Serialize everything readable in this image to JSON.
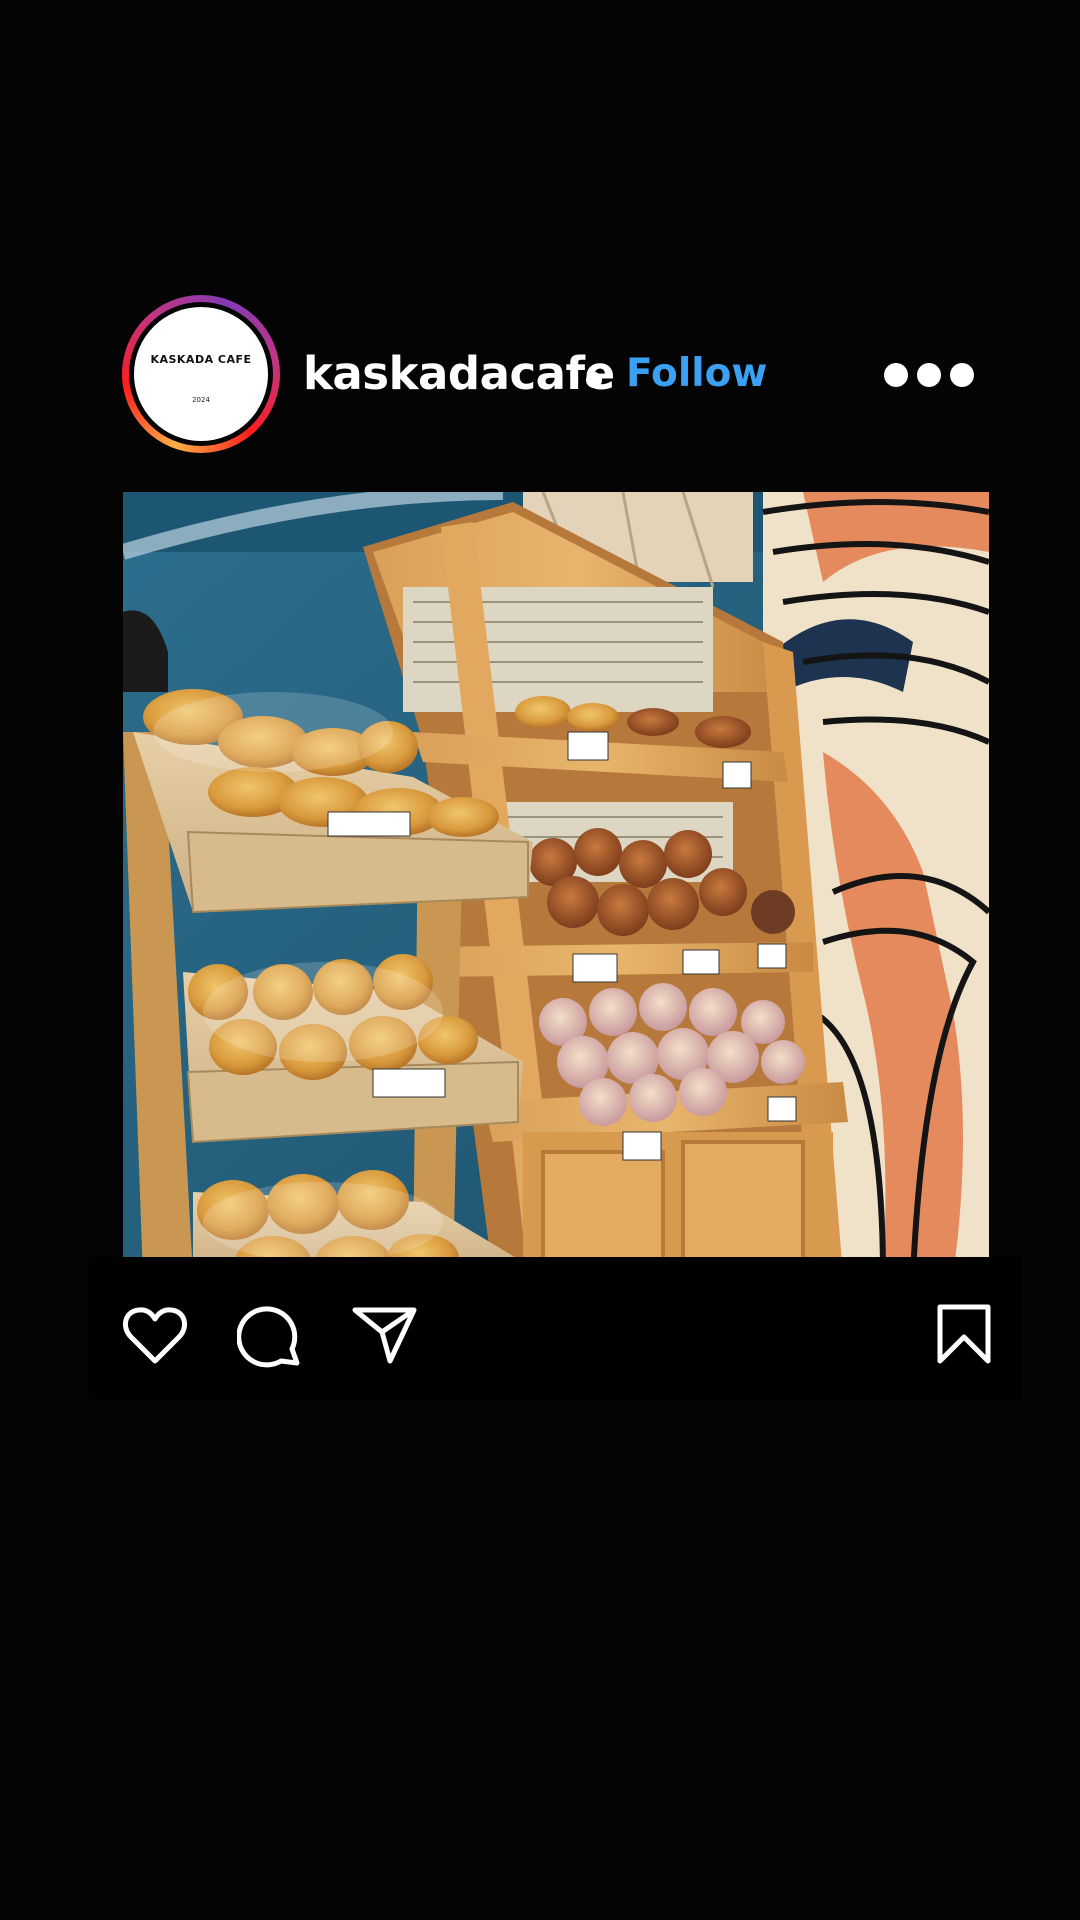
{
  "account": {
    "username": "kaskadacafe",
    "follow_label": "Follow",
    "avatar_text": "KASKADA CAFE",
    "avatar_year": "2024"
  },
  "post": {
    "image_subject": "bakery bread display shelves"
  },
  "actions": {
    "icons": [
      "heart-icon",
      "comment-icon",
      "share-icon",
      "bookmark-icon"
    ]
  },
  "colors": {
    "background": "#040404",
    "follow": "#3aa0f3",
    "text": "#ffffff"
  }
}
